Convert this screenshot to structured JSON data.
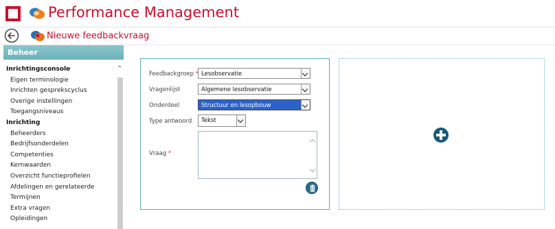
{
  "app": {
    "title": "Performance Management",
    "brand_color": "#c8102e",
    "accent_color": "#6ab2b9",
    "icons": [
      "app-grid-icon",
      "chat-bubbles-icon",
      "back-arrow-icon",
      "feedback-icon",
      "trash-icon",
      "plus-icon"
    ]
  },
  "page": {
    "title": "Nieuwe feedbackvraag"
  },
  "sidebar": {
    "header": "Beheer",
    "items": [
      {
        "label": "Inrichtingsconsole",
        "type": "group"
      },
      {
        "label": "Eigen terminologie",
        "type": "item"
      },
      {
        "label": "Inrichten gesprekscyclus",
        "type": "item"
      },
      {
        "label": "Overige instellingen",
        "type": "item"
      },
      {
        "label": "Toegangsniveaus",
        "type": "item"
      },
      {
        "label": "Inrichting",
        "type": "group"
      },
      {
        "label": "Beheerders",
        "type": "item"
      },
      {
        "label": "Bedrijfsonderdelen",
        "type": "item"
      },
      {
        "label": "Competenties",
        "type": "item"
      },
      {
        "label": "Kernwaarden",
        "type": "item"
      },
      {
        "label": "Overzicht functieprofielen",
        "type": "item"
      },
      {
        "label": "Afdelingen en gerelateerde",
        "type": "item"
      },
      {
        "label": "Termijnen",
        "type": "item"
      },
      {
        "label": "Extra vragen",
        "type": "item"
      },
      {
        "label": "Opleidingen",
        "type": "item"
      }
    ]
  },
  "form": {
    "feedbackgroep": {
      "label": "Feedbackgroep",
      "required_mark": "*",
      "value": "Lesobservatie"
    },
    "vragenlijst": {
      "label": "Vragenlijst",
      "value": "Algemene lesobservatie"
    },
    "onderdeel": {
      "label": "Onderdeel",
      "value": "Structuur en lesopbouw"
    },
    "type_antwoord": {
      "label": "Type antwoord",
      "value": "Tekst"
    },
    "vraag": {
      "label": "Vraag",
      "required_mark": "*",
      "value": ""
    }
  }
}
